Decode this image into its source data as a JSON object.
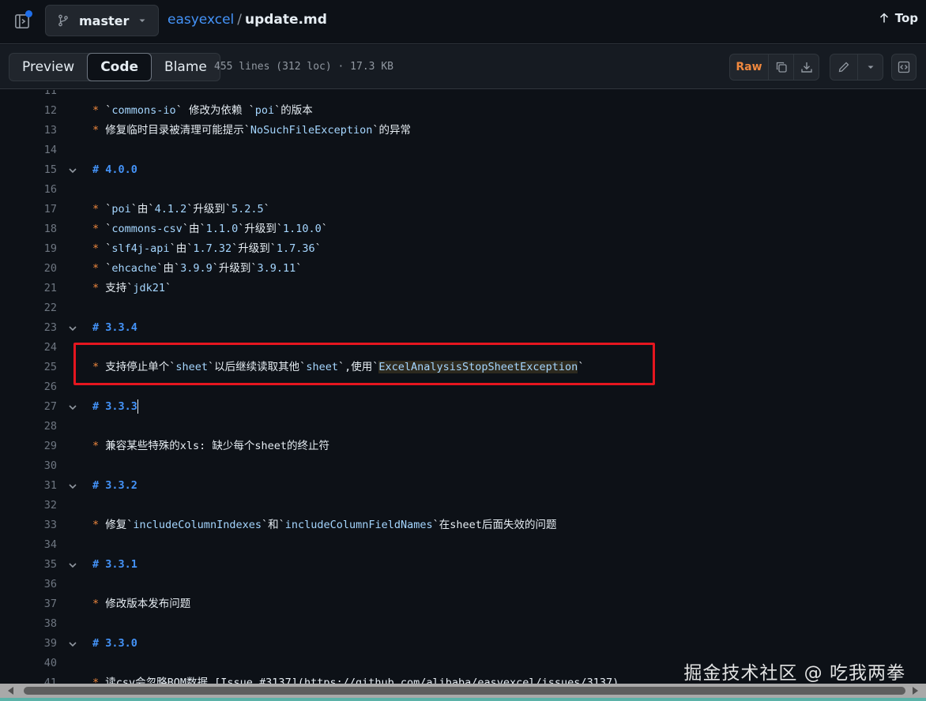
{
  "header": {
    "branch": "master",
    "repo": "easyexcel",
    "separator": "/",
    "file": "update.md",
    "top_label": "Top"
  },
  "toolbar": {
    "tabs": [
      {
        "label": "Preview",
        "active": false
      },
      {
        "label": "Code",
        "active": true
      },
      {
        "label": "Blame",
        "active": false
      }
    ],
    "meta": "455 lines (312 loc) · 17.3 KB",
    "raw_label": "Raw"
  },
  "code_lines": [
    {
      "n": "11",
      "segs": []
    },
    {
      "n": "12",
      "segs": [
        [
          "b",
          "* "
        ],
        [
          "t",
          "`"
        ],
        [
          "c",
          "commons-io"
        ],
        [
          "t",
          "` 修改为依赖 `"
        ],
        [
          "c",
          "poi"
        ],
        [
          "t",
          "`的版本"
        ]
      ]
    },
    {
      "n": "13",
      "segs": [
        [
          "b",
          "* "
        ],
        [
          "t",
          "修复临时目录被清理可能提示`"
        ],
        [
          "c",
          "NoSuchFileException"
        ],
        [
          "t",
          "`的异常"
        ]
      ]
    },
    {
      "n": "14",
      "segs": []
    },
    {
      "n": "15",
      "fold": true,
      "segs": [
        [
          "h",
          "# 4.0.0"
        ]
      ]
    },
    {
      "n": "16",
      "segs": []
    },
    {
      "n": "17",
      "segs": [
        [
          "b",
          "* "
        ],
        [
          "t",
          "`"
        ],
        [
          "c",
          "poi"
        ],
        [
          "t",
          "`由`"
        ],
        [
          "c",
          "4.1.2"
        ],
        [
          "t",
          "`升级到`"
        ],
        [
          "c",
          "5.2.5"
        ],
        [
          "t",
          "`"
        ]
      ]
    },
    {
      "n": "18",
      "segs": [
        [
          "b",
          "* "
        ],
        [
          "t",
          "`"
        ],
        [
          "c",
          "commons-csv"
        ],
        [
          "t",
          "`由`"
        ],
        [
          "c",
          "1.1.0"
        ],
        [
          "t",
          "`升级到`"
        ],
        [
          "c",
          "1.10.0"
        ],
        [
          "t",
          "`"
        ]
      ]
    },
    {
      "n": "19",
      "segs": [
        [
          "b",
          "* "
        ],
        [
          "t",
          "`"
        ],
        [
          "c",
          "slf4j-api"
        ],
        [
          "t",
          "`由`"
        ],
        [
          "c",
          "1.7.32"
        ],
        [
          "t",
          "`升级到`"
        ],
        [
          "c",
          "1.7.36"
        ],
        [
          "t",
          "`"
        ]
      ]
    },
    {
      "n": "20",
      "segs": [
        [
          "b",
          "* "
        ],
        [
          "t",
          "`"
        ],
        [
          "c",
          "ehcache"
        ],
        [
          "t",
          "`由`"
        ],
        [
          "c",
          "3.9.9"
        ],
        [
          "t",
          "`升级到`"
        ],
        [
          "c",
          "3.9.11"
        ],
        [
          "t",
          "`"
        ]
      ]
    },
    {
      "n": "21",
      "segs": [
        [
          "b",
          "* "
        ],
        [
          "t",
          "支持`"
        ],
        [
          "c",
          "jdk21"
        ],
        [
          "t",
          "`"
        ]
      ]
    },
    {
      "n": "22",
      "segs": []
    },
    {
      "n": "23",
      "fold": true,
      "segs": [
        [
          "h",
          "# 3.3.4"
        ]
      ]
    },
    {
      "n": "24",
      "segs": []
    },
    {
      "n": "25",
      "segs": [
        [
          "b",
          "* "
        ],
        [
          "t",
          "支持停止单个`"
        ],
        [
          "c",
          "sheet"
        ],
        [
          "t",
          "`以后继续读取其他`"
        ],
        [
          "c",
          "sheet"
        ],
        [
          "t",
          "`,使用`"
        ],
        [
          "chl",
          "ExcelAnalysisStopSheetException"
        ],
        [
          "t",
          "`"
        ]
      ]
    },
    {
      "n": "26",
      "segs": []
    },
    {
      "n": "27",
      "fold": true,
      "cursor": true,
      "segs": [
        [
          "h",
          "# 3.3.3"
        ]
      ]
    },
    {
      "n": "28",
      "segs": []
    },
    {
      "n": "29",
      "segs": [
        [
          "b",
          "* "
        ],
        [
          "t",
          "兼容某些特殊的xls: 缺少每个sheet的终止符"
        ]
      ]
    },
    {
      "n": "30",
      "segs": []
    },
    {
      "n": "31",
      "fold": true,
      "segs": [
        [
          "h",
          "# 3.3.2"
        ]
      ]
    },
    {
      "n": "32",
      "segs": []
    },
    {
      "n": "33",
      "segs": [
        [
          "b",
          "* "
        ],
        [
          "t",
          "修复`"
        ],
        [
          "c",
          "includeColumnIndexes"
        ],
        [
          "t",
          "`和`"
        ],
        [
          "c",
          "includeColumnFieldNames"
        ],
        [
          "t",
          "`在sheet后面失效的问题"
        ]
      ]
    },
    {
      "n": "34",
      "segs": []
    },
    {
      "n": "35",
      "fold": true,
      "segs": [
        [
          "h",
          "# 3.3.1"
        ]
      ]
    },
    {
      "n": "36",
      "segs": []
    },
    {
      "n": "37",
      "segs": [
        [
          "b",
          "* "
        ],
        [
          "t",
          "修改版本发布问题"
        ]
      ]
    },
    {
      "n": "38",
      "segs": []
    },
    {
      "n": "39",
      "fold": true,
      "segs": [
        [
          "h",
          "# 3.3.0"
        ]
      ]
    },
    {
      "n": "40",
      "segs": []
    },
    {
      "n": "41",
      "segs": [
        [
          "b",
          "* "
        ],
        [
          "t",
          "读csv会忽略BOM数据 [Issue #3137](https://github.com/alibaba/easyexcel/issues/3137)"
        ]
      ]
    }
  ],
  "watermark": "掘金技术社区 @ 吃我两拳",
  "colors": {
    "background": "#0d1117",
    "accent": "#4493f8",
    "bullet": "#f0883e",
    "code_span": "#a5d6ff",
    "highlight_box": "#e5161f"
  }
}
